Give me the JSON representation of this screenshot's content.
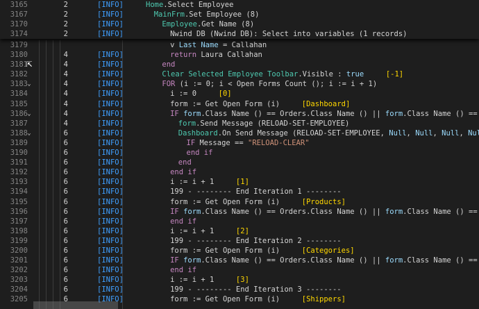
{
  "colors": {
    "default": "#d4d4d4",
    "keyword": "#c586c0",
    "ident": "#9cdcfe",
    "type": "#4ec9b0",
    "func": "#dcdcaa",
    "string": "#ce9178",
    "bracket": "#ffd700",
    "comment": "#6a9955",
    "info": "#3f9fff",
    "green": "#4ec9b0"
  },
  "sticky_lines": [
    {
      "num": "3165",
      "level": "2",
      "tag": "[INFO]",
      "indent": 0,
      "segments": [
        {
          "t": "Home",
          "c": "type"
        },
        {
          "t": ".Select Employee",
          "c": "default"
        }
      ]
    },
    {
      "num": "3167",
      "level": "2",
      "tag": "[INFO]",
      "indent": 1,
      "segments": [
        {
          "t": "MainFrm",
          "c": "type"
        },
        {
          "t": ".Set Employee (8)",
          "c": "default"
        }
      ]
    },
    {
      "num": "3170",
      "level": "2",
      "tag": "[INFO]",
      "indent": 2,
      "segments": [
        {
          "t": "Employee",
          "c": "type"
        },
        {
          "t": ".Get Name (8)",
          "c": "default"
        }
      ]
    },
    {
      "num": "3174",
      "level": "2",
      "tag": "[INFO]",
      "indent": 3,
      "segments": [
        {
          "t": "Nwind DB (Nwind DB): Select into variables (1 records)",
          "c": "default"
        }
      ]
    }
  ],
  "lines": [
    {
      "num": "3179",
      "fold": "",
      "level": "",
      "tag": "",
      "indent": 3,
      "segments": [
        {
          "t": "v ",
          "c": "default"
        },
        {
          "t": "Last Name",
          "c": "ident"
        },
        {
          "t": " = Callahan",
          "c": "default"
        }
      ]
    },
    {
      "num": "3180",
      "fold": "",
      "level": "4",
      "tag": "[INFO]",
      "indent": 3,
      "segments": [
        {
          "t": "return ",
          "c": "keyword"
        },
        {
          "t": "Laura Callahan",
          "c": "default"
        }
      ]
    },
    {
      "num": "3181",
      "fold": "",
      "level": "4",
      "tag": "[INFO]",
      "indent": 2,
      "segments": [
        {
          "t": "end",
          "c": "keyword"
        }
      ]
    },
    {
      "num": "3182",
      "fold": "",
      "level": "4",
      "tag": "[INFO]",
      "indent": 2,
      "segments": [
        {
          "t": "Clear Selected Employee Toolbar",
          "c": "type"
        },
        {
          "t": ".Visible : ",
          "c": "default"
        },
        {
          "t": "true",
          "c": "ident"
        },
        {
          "t": "     ",
          "c": "default"
        },
        {
          "t": "[-1]",
          "c": "bracket"
        }
      ]
    },
    {
      "num": "3183",
      "fold": "⌄",
      "level": "4",
      "tag": "[INFO]",
      "indent": 2,
      "segments": [
        {
          "t": "FOR",
          "c": "keyword"
        },
        {
          "t": " (i := 0; i < Open Forms Count (); i := i + 1)",
          "c": "default"
        }
      ]
    },
    {
      "num": "3184",
      "fold": "",
      "level": "4",
      "tag": "[INFO]",
      "indent": 3,
      "segments": [
        {
          "t": "i := 0     ",
          "c": "default"
        },
        {
          "t": "[0]",
          "c": "bracket"
        }
      ]
    },
    {
      "num": "3185",
      "fold": "",
      "level": "4",
      "tag": "[INFO]",
      "indent": 3,
      "segments": [
        {
          "t": "form := Get Open Form (i)     ",
          "c": "default"
        },
        {
          "t": "[Dashboard]",
          "c": "bracket"
        }
      ]
    },
    {
      "num": "3186",
      "fold": "⌄",
      "level": "4",
      "tag": "[INFO]",
      "indent": 3,
      "segments": [
        {
          "t": "IF ",
          "c": "keyword"
        },
        {
          "t": "form",
          "c": "ident"
        },
        {
          "t": ".Class Name () == Orders.Class Name () || ",
          "c": "default"
        },
        {
          "t": "form",
          "c": "ident"
        },
        {
          "t": ".Class Name () == Dashbo",
          "c": "default"
        }
      ]
    },
    {
      "num": "3187",
      "fold": "",
      "level": "4",
      "tag": "[INFO]",
      "indent": 4,
      "segments": [
        {
          "t": "form",
          "c": "type"
        },
        {
          "t": ".Send Message (RELOAD-SET-EMPLOYEE)",
          "c": "default"
        }
      ]
    },
    {
      "num": "3188",
      "fold": "⌄",
      "level": "6",
      "tag": "[INFO]",
      "indent": 4,
      "segments": [
        {
          "t": "Dashboard",
          "c": "type"
        },
        {
          "t": ".On Send Message (RELOAD-SET-EMPLOYEE, ",
          "c": "default"
        },
        {
          "t": "Null",
          "c": "ident"
        },
        {
          "t": ", ",
          "c": "default"
        },
        {
          "t": "Null",
          "c": "ident"
        },
        {
          "t": ", ",
          "c": "default"
        },
        {
          "t": "Null",
          "c": "ident"
        },
        {
          "t": ", ",
          "c": "default"
        },
        {
          "t": "Null",
          "c": "ident"
        },
        {
          "t": ", ",
          "c": "default"
        },
        {
          "t": "Null",
          "c": "ident"
        }
      ]
    },
    {
      "num": "3189",
      "fold": "",
      "level": "6",
      "tag": "[INFO]",
      "indent": 5,
      "segments": [
        {
          "t": "IF ",
          "c": "keyword"
        },
        {
          "t": "Message == ",
          "c": "default"
        },
        {
          "t": "\"RELOAD-CLEAR\"",
          "c": "string"
        }
      ]
    },
    {
      "num": "3190",
      "fold": "",
      "level": "6",
      "tag": "[INFO]",
      "indent": 5,
      "segments": [
        {
          "t": "end if",
          "c": "keyword"
        }
      ]
    },
    {
      "num": "3191",
      "fold": "",
      "level": "6",
      "tag": "[INFO]",
      "indent": 4,
      "segments": [
        {
          "t": "end",
          "c": "keyword"
        }
      ]
    },
    {
      "num": "3192",
      "fold": "",
      "level": "6",
      "tag": "[INFO]",
      "indent": 3,
      "segments": [
        {
          "t": "end if",
          "c": "keyword"
        }
      ]
    },
    {
      "num": "3193",
      "fold": "",
      "level": "6",
      "tag": "[INFO]",
      "indent": 3,
      "segments": [
        {
          "t": "i := i + 1     ",
          "c": "default"
        },
        {
          "t": "[1]",
          "c": "bracket"
        }
      ]
    },
    {
      "num": "3194",
      "fold": "",
      "level": "6",
      "tag": "[INFO]",
      "indent": 3,
      "segments": [
        {
          "t": "199 - -------- End Iteration 1 --------",
          "c": "default"
        }
      ]
    },
    {
      "num": "3195",
      "fold": "",
      "level": "6",
      "tag": "[INFO]",
      "indent": 3,
      "segments": [
        {
          "t": "form := Get Open Form (i)     ",
          "c": "default"
        },
        {
          "t": "[Products]",
          "c": "bracket"
        }
      ]
    },
    {
      "num": "3196",
      "fold": "",
      "level": "6",
      "tag": "[INFO]",
      "indent": 3,
      "segments": [
        {
          "t": "IF ",
          "c": "keyword"
        },
        {
          "t": "form",
          "c": "ident"
        },
        {
          "t": ".Class Name () == Orders.Class Name () || ",
          "c": "default"
        },
        {
          "t": "form",
          "c": "ident"
        },
        {
          "t": ".Class Name () == Dashbo",
          "c": "default"
        }
      ]
    },
    {
      "num": "3197",
      "fold": "",
      "level": "6",
      "tag": "[INFO]",
      "indent": 3,
      "segments": [
        {
          "t": "end if",
          "c": "keyword"
        }
      ]
    },
    {
      "num": "3198",
      "fold": "",
      "level": "6",
      "tag": "[INFO]",
      "indent": 3,
      "segments": [
        {
          "t": "i := i + 1     ",
          "c": "default"
        },
        {
          "t": "[2]",
          "c": "bracket"
        }
      ]
    },
    {
      "num": "3199",
      "fold": "",
      "level": "6",
      "tag": "[INFO]",
      "indent": 3,
      "segments": [
        {
          "t": "199 - -------- End Iteration 2 --------",
          "c": "default"
        }
      ]
    },
    {
      "num": "3200",
      "fold": "",
      "level": "6",
      "tag": "[INFO]",
      "indent": 3,
      "segments": [
        {
          "t": "form := Get Open Form (i)     ",
          "c": "default"
        },
        {
          "t": "[Categories]",
          "c": "bracket"
        }
      ]
    },
    {
      "num": "3201",
      "fold": "",
      "level": "6",
      "tag": "[INFO]",
      "indent": 3,
      "segments": [
        {
          "t": "IF ",
          "c": "keyword"
        },
        {
          "t": "form",
          "c": "ident"
        },
        {
          "t": ".Class Name () == Orders.Class Name () || ",
          "c": "default"
        },
        {
          "t": "form",
          "c": "ident"
        },
        {
          "t": ".Class Name () == Dashbo",
          "c": "default"
        }
      ]
    },
    {
      "num": "3202",
      "fold": "",
      "level": "6",
      "tag": "[INFO]",
      "indent": 3,
      "segments": [
        {
          "t": "end if",
          "c": "keyword"
        }
      ]
    },
    {
      "num": "3203",
      "fold": "",
      "level": "6",
      "tag": "[INFO]",
      "indent": 3,
      "segments": [
        {
          "t": "i := i + 1     ",
          "c": "default"
        },
        {
          "t": "[3]",
          "c": "bracket"
        }
      ]
    },
    {
      "num": "3204",
      "fold": "",
      "level": "6",
      "tag": "[INFO]",
      "indent": 3,
      "segments": [
        {
          "t": "199 - -------- End Iteration 3 --------",
          "c": "default"
        }
      ]
    },
    {
      "num": "3205",
      "fold": "",
      "level": "6",
      "tag": "[INFO]",
      "indent": 3,
      "segments": [
        {
          "t": "form := Get Open Form (i)     ",
          "c": "default"
        },
        {
          "t": "[Shippers]",
          "c": "bracket"
        }
      ]
    }
  ]
}
